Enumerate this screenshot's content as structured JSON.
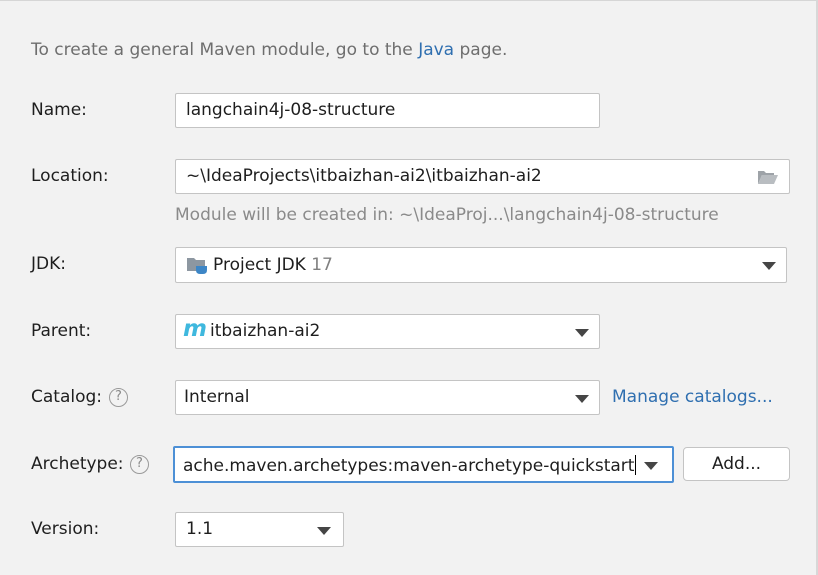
{
  "intro": {
    "prefix": "To create a general Maven module, go to the",
    "link": "Java",
    "suffix": "page."
  },
  "name": {
    "label": "Name:",
    "value": "langchain4j-08-structure"
  },
  "location": {
    "label": "Location:",
    "value": "~\\IdeaProjects\\itbaizhan-ai2\\itbaizhan-ai2",
    "hint": "Module will be created in: ~\\IdeaProj...\\langchain4j-08-structure",
    "icon": "folder-open-icon"
  },
  "jdk": {
    "label": "JDK:",
    "value": "Project JDK",
    "version": "17",
    "icon": "jdk-folder-icon"
  },
  "parent": {
    "label": "Parent:",
    "value": "itbaizhan-ai2",
    "icon": "maven-icon",
    "icon_glyph": "m"
  },
  "catalog": {
    "label": "Catalog:",
    "value": "Internal",
    "help": "?",
    "manage_link": "Manage catalogs..."
  },
  "archetype": {
    "label": "Archetype:",
    "value": "ache.maven.archetypes:maven-archetype-quickstart",
    "help": "?",
    "add_button": "Add..."
  },
  "version": {
    "label": "Version:",
    "value": "1.1"
  },
  "colors": {
    "accent": "#2f6fb0",
    "focus": "#4d90d6",
    "background": "#f2f2f2"
  }
}
